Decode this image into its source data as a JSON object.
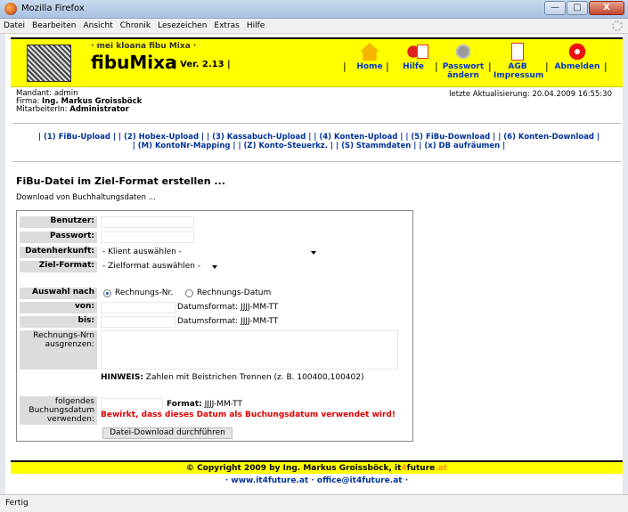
{
  "window": {
    "title": "Mozilla Firefox",
    "controls": [
      "—",
      "□",
      "X"
    ]
  },
  "menubar": [
    "Datei",
    "Bearbeiten",
    "Ansicht",
    "Chronik",
    "Lesezeichen",
    "Extras",
    "Hilfe"
  ],
  "header": {
    "claim": "· mei kloana fibu Mixa ·",
    "brand": "fibuMixa",
    "version": "| Ver. 2.13 |",
    "nav": {
      "home": "Home",
      "help": "Hilfe",
      "password": "Passwort ändern",
      "agb": "AGB Impressum",
      "logout": "Abmelden"
    }
  },
  "session": {
    "mandant": "Mandant: admin",
    "firma_label": "Firma:",
    "firma": "Ing. Markus Groissböck",
    "mitarbeiter_label": "MitarbeiterIn:",
    "mitarbeiter": "Administrator",
    "updated": "letzte Aktualisierung: 20.04.2009 16:55:30"
  },
  "navlinks": {
    "line1": "| (1) FiBu-Upload | | (2) Hobex-Upload | | (3) Kassabuch-Upload | | (4) Konten-Upload | | (5) FiBu-Download | | (6) Konten-Download |",
    "line2": "| (M) KontoNr-Mapping | | (Z) Konto-Steuerkz. | | (S) Stammdaten | | (x) DB aufräumen |"
  },
  "page": {
    "title": "FiBu-Datei im Ziel-Format erstellen ...",
    "subtitle": "Download von Buchhaltungsdaten ..."
  },
  "form": {
    "benutzer_label": "Benutzer:",
    "passwort_label": "Passwort:",
    "datenherkunft_label": "Datenherkunft:",
    "datenherkunft_value": "- Klient auswählen -",
    "zielformat_label": "Ziel-Format:",
    "zielformat_value": "- Zielformat auswählen -",
    "auswahl_label": "Auswahl nach",
    "radio_rechnungsnr": "Rechnungs-Nr.",
    "radio_rechnungsdatum": "Rechnungs-Datum",
    "von_label": "von:",
    "bis_label": "bis:",
    "datumsformat": "Datumsformat: JJJJ-MM-TT",
    "ausgrenzen_label": "Rechnungs-Nrn ausgrenzen:",
    "hinweis_label": "HINWEIS:",
    "hinweis_text": "Zahlen mit Beistrichen Trennen (z. B. 100400,100402)",
    "buchungsdatum_label": "folgendes Buchungsdatum verwenden:",
    "format_label": "Format:",
    "format_value": "JJJJ-MM-TT",
    "buchungsdatum_hint": "Bewirkt, dass dieses Datum als Buchungsdatum verwendet wird!",
    "submit": "Datei-Download durchführen"
  },
  "footer": {
    "copyright_prefix": "© Copyright 2009 by Ing. Markus Groissböck, it",
    "copyright_4": "4",
    "copyright_future": "future",
    "copyright_at": ".at",
    "links": "· www.it4future.at · office@it4future.at ·"
  },
  "statusbar": "Fertig",
  "colors": {
    "header_bg": "#ffff00",
    "link": "#003399",
    "warning": "#e00000",
    "footer_accent": "#ff9900"
  }
}
